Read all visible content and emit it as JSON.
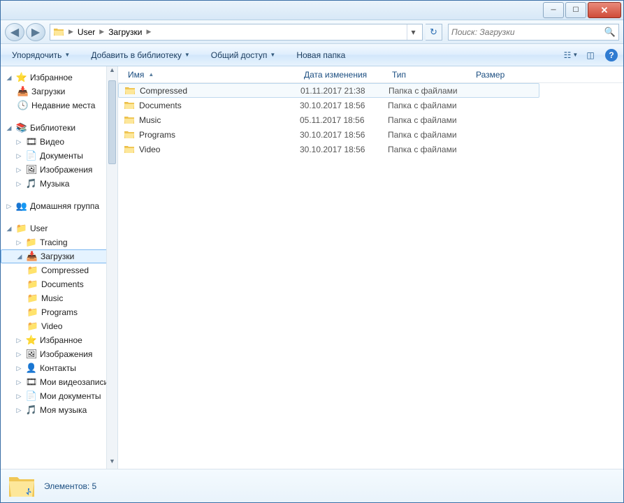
{
  "breadcrumb": {
    "segments": [
      "User",
      "Загрузки"
    ]
  },
  "search": {
    "placeholder": "Поиск: Загрузки"
  },
  "toolbar": {
    "organize": "Упорядочить",
    "add_library": "Добавить в библиотеку",
    "share": "Общий доступ",
    "new_folder": "Новая папка"
  },
  "columns": {
    "name": "Имя",
    "date": "Дата изменения",
    "type": "Тип",
    "size": "Размер"
  },
  "files": {
    "rows": [
      {
        "name": "Compressed",
        "date": "01.11.2017 21:38",
        "type": "Папка с файлами"
      },
      {
        "name": "Documents",
        "date": "30.10.2017 18:56",
        "type": "Папка с файлами"
      },
      {
        "name": "Music",
        "date": "05.11.2017 18:56",
        "type": "Папка с файлами"
      },
      {
        "name": "Programs",
        "date": "30.10.2017 18:56",
        "type": "Папка с файлами"
      },
      {
        "name": "Video",
        "date": "30.10.2017 18:56",
        "type": "Папка с файлами"
      }
    ]
  },
  "sidebar": {
    "favorites": {
      "title": "Избранное",
      "items": [
        "Загрузки",
        "Недавние места"
      ]
    },
    "libraries": {
      "title": "Библиотеки",
      "items": [
        "Видео",
        "Документы",
        "Изображения",
        "Музыка"
      ]
    },
    "homegroup": "Домашняя группа",
    "user": {
      "title": "User",
      "items": [
        "Tracing"
      ],
      "downloads": {
        "title": "Загрузки",
        "items": [
          "Compressed",
          "Documents",
          "Music",
          "Programs",
          "Video"
        ]
      },
      "more": [
        "Избранное",
        "Изображения",
        "Контакты",
        "Мои видеозаписи",
        "Мои документы",
        "Моя музыка"
      ]
    }
  },
  "status": {
    "text": "Элементов: 5"
  }
}
